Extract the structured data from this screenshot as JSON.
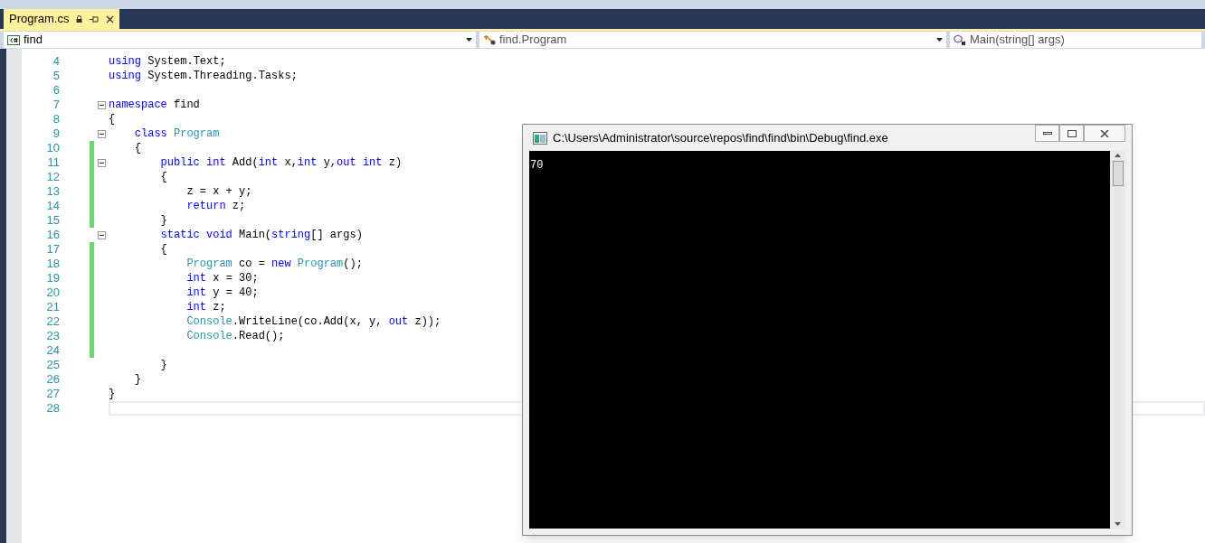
{
  "tabs": [
    {
      "label": "Program.cs",
      "selected": true
    }
  ],
  "navigation": {
    "project": "find",
    "type": "find.Program",
    "member": "Main(string[] args)"
  },
  "code_lines": [
    {
      "number": "4",
      "changed": false,
      "fold": false,
      "tokens": [
        {
          "text": "using",
          "kind": "keyword"
        },
        {
          "text": " System.Text;",
          "kind": "plain"
        }
      ]
    },
    {
      "number": "5",
      "changed": false,
      "fold": false,
      "tokens": [
        {
          "text": "using",
          "kind": "keyword"
        },
        {
          "text": " System.Threading.Tasks;",
          "kind": "plain"
        }
      ]
    },
    {
      "number": "6",
      "changed": false,
      "fold": false
    },
    {
      "number": "7",
      "changed": false,
      "fold": true,
      "tokens": [
        {
          "text": "namespace",
          "kind": "keyword"
        },
        {
          "text": " find",
          "kind": "plain"
        }
      ]
    },
    {
      "number": "8",
      "changed": false,
      "fold": false,
      "tokens": [
        {
          "text": "{",
          "kind": "plain"
        }
      ]
    },
    {
      "number": "9",
      "changed": false,
      "fold": true,
      "tokens": [
        {
          "text": "    class",
          "kind": "keyword"
        },
        {
          "text": " Program",
          "kind": "type"
        }
      ]
    },
    {
      "number": "10",
      "changed": true,
      "fold": false,
      "tokens": [
        {
          "text": "    {",
          "kind": "plain"
        }
      ]
    },
    {
      "number": "11",
      "changed": true,
      "fold": true,
      "tokens": [
        {
          "text": "        public int",
          "kind": "keyword"
        },
        {
          "text": " Add(",
          "kind": "plain"
        },
        {
          "text": "int",
          "kind": "keyword"
        },
        {
          "text": " x,",
          "kind": "plain"
        },
        {
          "text": "int",
          "kind": "keyword"
        },
        {
          "text": " y,",
          "kind": "plain"
        },
        {
          "text": "out int",
          "kind": "keyword"
        },
        {
          "text": " z)",
          "kind": "plain"
        }
      ]
    },
    {
      "number": "12",
      "changed": true,
      "fold": false,
      "tokens": [
        {
          "text": "        {",
          "kind": "plain"
        }
      ]
    },
    {
      "number": "13",
      "changed": true,
      "fold": false,
      "tokens": [
        {
          "text": "            z = x + y;",
          "kind": "plain"
        }
      ]
    },
    {
      "number": "14",
      "changed": true,
      "fold": false,
      "tokens": [
        {
          "text": "            return",
          "kind": "keyword"
        },
        {
          "text": " z;",
          "kind": "plain"
        }
      ]
    },
    {
      "number": "15",
      "changed": true,
      "fold": false,
      "tokens": [
        {
          "text": "        }",
          "kind": "plain"
        }
      ]
    },
    {
      "number": "16",
      "changed": false,
      "fold": true,
      "tokens": [
        {
          "text": "        static void",
          "kind": "keyword"
        },
        {
          "text": " Main(",
          "kind": "plain"
        },
        {
          "text": "string",
          "kind": "keyword"
        },
        {
          "text": "[] args)",
          "kind": "plain"
        }
      ]
    },
    {
      "number": "17",
      "changed": true,
      "fold": false,
      "tokens": [
        {
          "text": "        {",
          "kind": "plain"
        }
      ]
    },
    {
      "number": "18",
      "changed": true,
      "fold": false,
      "tokens": [
        {
          "text": "            Program",
          "kind": "type"
        },
        {
          "text": " co = ",
          "kind": "plain"
        },
        {
          "text": "new",
          "kind": "keyword"
        },
        {
          "text": " Program",
          "kind": "type"
        },
        {
          "text": "();",
          "kind": "plain"
        }
      ]
    },
    {
      "number": "19",
      "changed": true,
      "fold": false,
      "tokens": [
        {
          "text": "            int",
          "kind": "keyword"
        },
        {
          "text": " x = 30;",
          "kind": "plain"
        }
      ]
    },
    {
      "number": "20",
      "changed": true,
      "fold": false,
      "tokens": [
        {
          "text": "            int",
          "kind": "keyword"
        },
        {
          "text": " y = 40;",
          "kind": "plain"
        }
      ]
    },
    {
      "number": "21",
      "changed": true,
      "fold": false,
      "tokens": [
        {
          "text": "            int",
          "kind": "keyword"
        },
        {
          "text": " z;",
          "kind": "plain"
        }
      ]
    },
    {
      "number": "22",
      "changed": true,
      "fold": false,
      "tokens": [
        {
          "text": "            Console",
          "kind": "type"
        },
        {
          "text": ".WriteLine(co.Add(x, y, ",
          "kind": "plain"
        },
        {
          "text": "out",
          "kind": "keyword"
        },
        {
          "text": " z));",
          "kind": "plain"
        }
      ]
    },
    {
      "number": "23",
      "changed": true,
      "fold": false,
      "tokens": [
        {
          "text": "            Console",
          "kind": "type"
        },
        {
          "text": ".Read();",
          "kind": "plain"
        }
      ]
    },
    {
      "number": "24",
      "changed": true,
      "fold": false
    },
    {
      "number": "25",
      "changed": false,
      "fold": false,
      "tokens": [
        {
          "text": "        }",
          "kind": "plain"
        }
      ]
    },
    {
      "number": "26",
      "changed": false,
      "fold": false,
      "tokens": [
        {
          "text": "    }",
          "kind": "plain"
        }
      ]
    },
    {
      "number": "27",
      "changed": false,
      "fold": false,
      "tokens": [
        {
          "text": "}",
          "kind": "plain"
        }
      ]
    },
    {
      "number": "28",
      "changed": false,
      "fold": false,
      "current": true
    }
  ],
  "console": {
    "title": "C:\\Users\\Administrator\\source\\repos\\find\\find\\bin\\Debug\\find.exe",
    "output": "70"
  }
}
